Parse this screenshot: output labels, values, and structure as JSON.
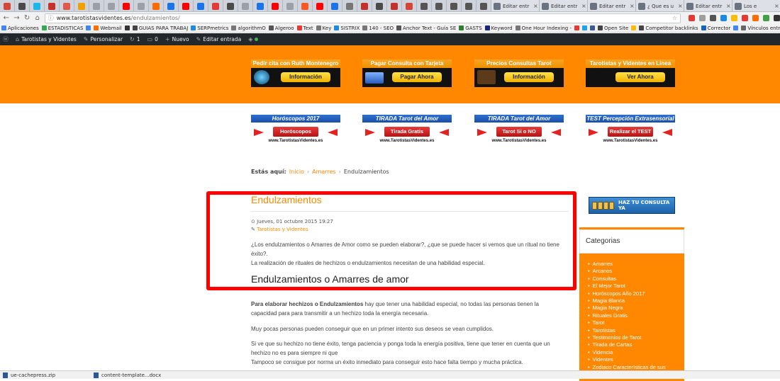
{
  "browser": {
    "tabs": [
      {
        "icon": "gmail-icon",
        "color": "#d44638"
      },
      {
        "icon": "chevron-icon",
        "color": "#4a4a4a"
      },
      {
        "icon": "vimeo-icon",
        "color": "#1ab7ea"
      },
      {
        "icon": "w-icon",
        "color": "#c4302b"
      },
      {
        "icon": "link-icon",
        "color": "#e05a47"
      },
      {
        "icon": "w-icon",
        "color": "#f0a000"
      },
      {
        "icon": "doc-icon",
        "color": "#9aa0a6"
      },
      {
        "icon": "doc-icon",
        "color": "#9aa0a6"
      },
      {
        "icon": "youtube-icon",
        "color": "#ff0000"
      },
      {
        "icon": "doc-icon",
        "color": "#9aa0a6"
      },
      {
        "icon": "sw-icon",
        "color": "#ff6a00"
      },
      {
        "icon": "triangle-icon",
        "color": "#1a73e8"
      },
      {
        "icon": "youtube-icon",
        "color": "#ff0000"
      },
      {
        "icon": "drive-icon",
        "color": "#1a73e8"
      },
      {
        "icon": "pen-icon",
        "color": "#e53935"
      },
      {
        "icon": "chevron-icon",
        "color": "#4a4a4a"
      },
      {
        "icon": "doc-icon",
        "color": "#9aa0a6"
      },
      {
        "icon": "triangle-icon",
        "color": "#1a73e8"
      },
      {
        "icon": "youtube-icon",
        "color": "#ff0000"
      },
      {
        "icon": "doc-icon",
        "color": "#9aa0a6"
      },
      {
        "icon": "a-icon",
        "color": "#ff5722"
      },
      {
        "icon": "youtube-icon",
        "color": "#ff0000"
      },
      {
        "icon": "triangle-icon",
        "color": "#1a73e8"
      },
      {
        "icon": "bolt-icon",
        "color": "#777"
      },
      {
        "icon": "w-icon",
        "color": "#c4302b"
      },
      {
        "icon": "chevron-icon",
        "color": "#4a4a4a"
      },
      {
        "icon": "w-icon",
        "color": "#c4302b"
      },
      {
        "icon": "gmail-icon",
        "color": "#d44638"
      },
      {
        "icon": "mail-icon",
        "color": "#555"
      },
      {
        "icon": "image-icon",
        "color": "#555"
      },
      {
        "icon": "image-icon",
        "color": "#555"
      },
      {
        "icon": "image-icon",
        "color": "#555"
      },
      {
        "icon": "image-icon",
        "color": "#555"
      }
    ],
    "wide_tabs": [
      "Editar entr",
      "Editar entr",
      "Editar entr",
      "¿ Que es u",
      "Editar entr",
      "Los e"
    ],
    "url_domain": "www.tarotistasvidentes.es",
    "url_path": "/endulzamientos/",
    "bookmarks": [
      {
        "label": "Aplicaciones",
        "color": "#4285f4"
      },
      {
        "label": "ESTADISTICAS",
        "color": "#34a853"
      },
      {
        "label": "",
        "color": "#4285f4"
      },
      {
        "label": "Webmail",
        "color": "#ff6d00"
      },
      {
        "label": "",
        "color": "#333"
      },
      {
        "label": "GUIAS PARA TRABAJ",
        "color": "#444"
      },
      {
        "label": "SERPmetrics",
        "color": "#1e88e5"
      },
      {
        "label": "algorithmO",
        "color": "#777"
      },
      {
        "label": "Algeroo",
        "color": "#555"
      },
      {
        "label": "Text",
        "color": "#e53935"
      },
      {
        "label": "Key",
        "color": "#777"
      },
      {
        "label": "SISTRIX",
        "color": "#1e88e5"
      },
      {
        "label": "140 - SEO",
        "color": "#777"
      },
      {
        "label": "Anchor Text - Guía SE",
        "color": "#555"
      },
      {
        "label": "GASTS",
        "color": "#2e7d32"
      },
      {
        "label": "Keyword",
        "color": "#1a237e"
      },
      {
        "label": "One Hour Indexing -",
        "color": "#777"
      },
      {
        "label": "",
        "color": "#e53935"
      },
      {
        "label": "",
        "color": "#1da1f2"
      },
      {
        "label": "",
        "color": "#3b5998"
      },
      {
        "label": "Open Site",
        "color": "#444"
      },
      {
        "label": "",
        "color": "#fbbc05"
      },
      {
        "label": "Competitor backlinks",
        "color": "#444"
      },
      {
        "label": "Corrector",
        "color": "#1565c0"
      },
      {
        "label": "",
        "color": "#4285f4"
      },
      {
        "label": "Vínculos entran",
        "color": "#666"
      }
    ],
    "downloads": [
      "ue-cachepress.zip",
      "content-template...docx"
    ]
  },
  "adminbar": {
    "site": "Tarotistas y Videntes",
    "customize": "Personalizar",
    "updates": "1",
    "comments": "0",
    "new": "Nuevo",
    "edit": "Editar entrada"
  },
  "header_banners": [
    {
      "caption": "Pedir cita con Ruth Montenegro",
      "button": "Información"
    },
    {
      "caption": "Pagar Consulta con Tarjeta",
      "button": "Pagar Ahora"
    },
    {
      "caption": "Precios Consultas Tarot",
      "button": "Información"
    },
    {
      "caption": "Tarotistas y Videntes en Línea",
      "button": "Ver Ahora"
    }
  ],
  "sub_banners": [
    {
      "caption": "Horóscopos 2017",
      "button": "Horóscopos",
      "site": "www.TarotistasVidentes.es"
    },
    {
      "caption": "TIRADA   Tarot del Amor",
      "button": "Tirada Gratis",
      "site": "www.TarotistasVidentes.es"
    },
    {
      "caption": "TIRADA   Tarot del Amor",
      "button": "Tarot Si o NO",
      "site": "www.TarotistasVidentes.es"
    },
    {
      "caption": "TEST Percepción Extrasensorial",
      "button": "Realizar el TEST",
      "site": "www.TarotistasVidentes.es"
    }
  ],
  "breadcrumb": {
    "label": "Estás aquí:",
    "items": [
      "Inicio",
      "Amarres",
      "Endulzamientos"
    ]
  },
  "article": {
    "title": "Endulzamientos",
    "date": "Jueves, 01 octubre 2015 19:27",
    "category": "Tarotistas y Videntes",
    "intro1": "¿Los endulzamientos o Amarres de Amor como se pueden elaborar?, ¿que se puede hacer si vemos que un ritual no tiene éxito?.",
    "intro2": "La realización de rituales de hechizos o endulzamientos necesitan de una habilidad especial.",
    "h2": "Endulzamientos o Amarres de amor",
    "p1_bold": "Para elaborar hechizos o Endulzamientos",
    "p1_rest": " hay que tener una habilidad especial, no todas las personas tienen la capacidad para para transmitir a un hechizo toda la energía necesaria.",
    "p2": "Muy pocas personas pueden conseguir que en un primer intento sus deseos se vean cumplidos.",
    "p3": "Si ve que su hechizo no tiene éxito, tenga paciencia y ponga toda la energía positiva, tiene que tener en cuenta que un hechizo no es para siempre ni que",
    "p4": "Tampoco se consigue por norma un éxito inmediato para conseguir esto hace falta tiempo y mucha práctica."
  },
  "sidebar": {
    "consulta_label": "HAZ TU CONSULTA YA",
    "widget_title": "Categorias",
    "categories": [
      "Amarres",
      "Arcanos",
      "Consultas",
      "El Mejor Tarot",
      "Horóscopos Año 2017",
      "Magia Blanca",
      "Magia Negra",
      "Rituales Gratis",
      "Tarot",
      "Tarotistas",
      "Testimonios de Tarot",
      "Tirada de Cartas",
      "Videncia",
      "Videntes",
      "Zodiaco Características de sus"
    ]
  },
  "colors": {
    "accent": "#ff8800",
    "highlight": "#ff0000",
    "adminbar": "#23282d"
  }
}
